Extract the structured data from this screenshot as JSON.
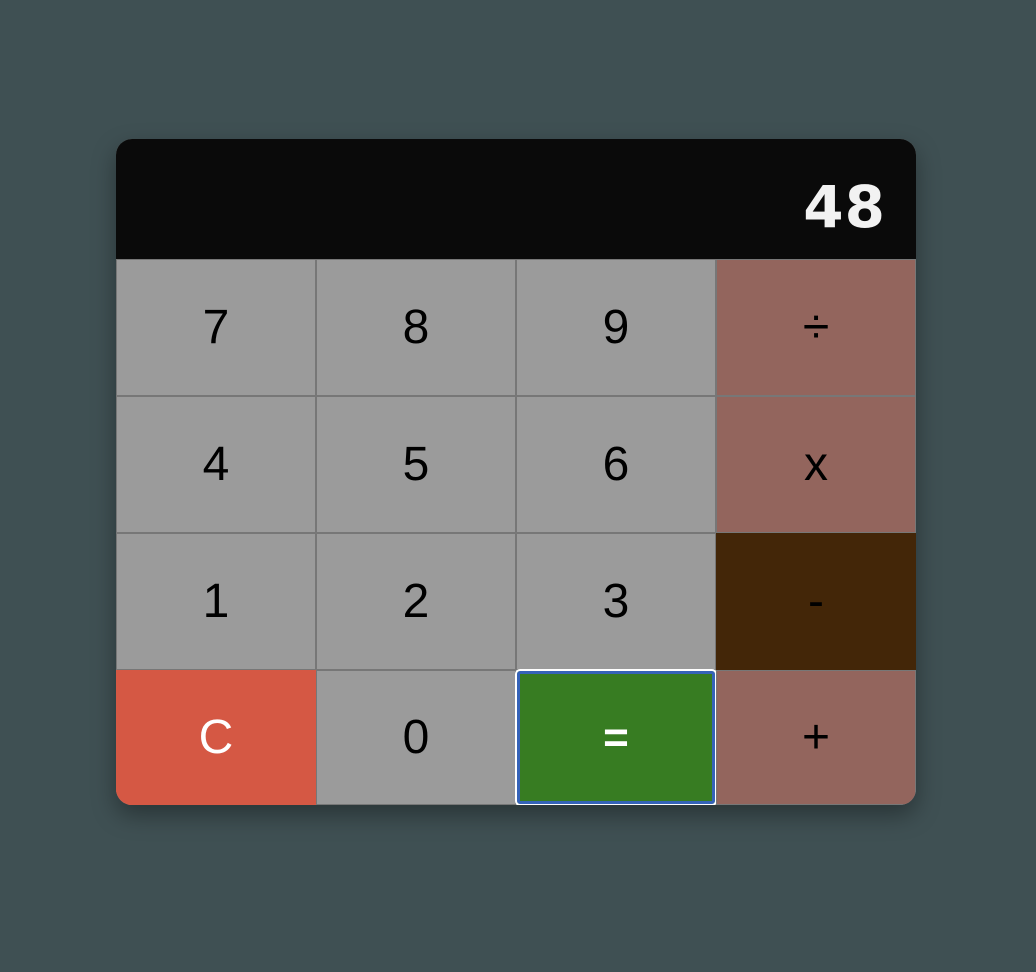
{
  "display": {
    "value": "48"
  },
  "keys": {
    "k7": "7",
    "k8": "8",
    "k9": "9",
    "divide": "÷",
    "k4": "4",
    "k5": "5",
    "k6": "6",
    "multiply": "x",
    "k1": "1",
    "k2": "2",
    "k3": "3",
    "subtract": "-",
    "clear": "C",
    "k0": "0",
    "equals": "=",
    "add": "+"
  },
  "colors": {
    "background": "#3f5053",
    "display": "#0a0a0a",
    "digit_key": "#9b9b9b",
    "operator_key": "#93655d",
    "operator_active": "#432608",
    "clear_key": "#d55844",
    "equals_key": "#377c22",
    "focus_ring": "#3563b8"
  }
}
